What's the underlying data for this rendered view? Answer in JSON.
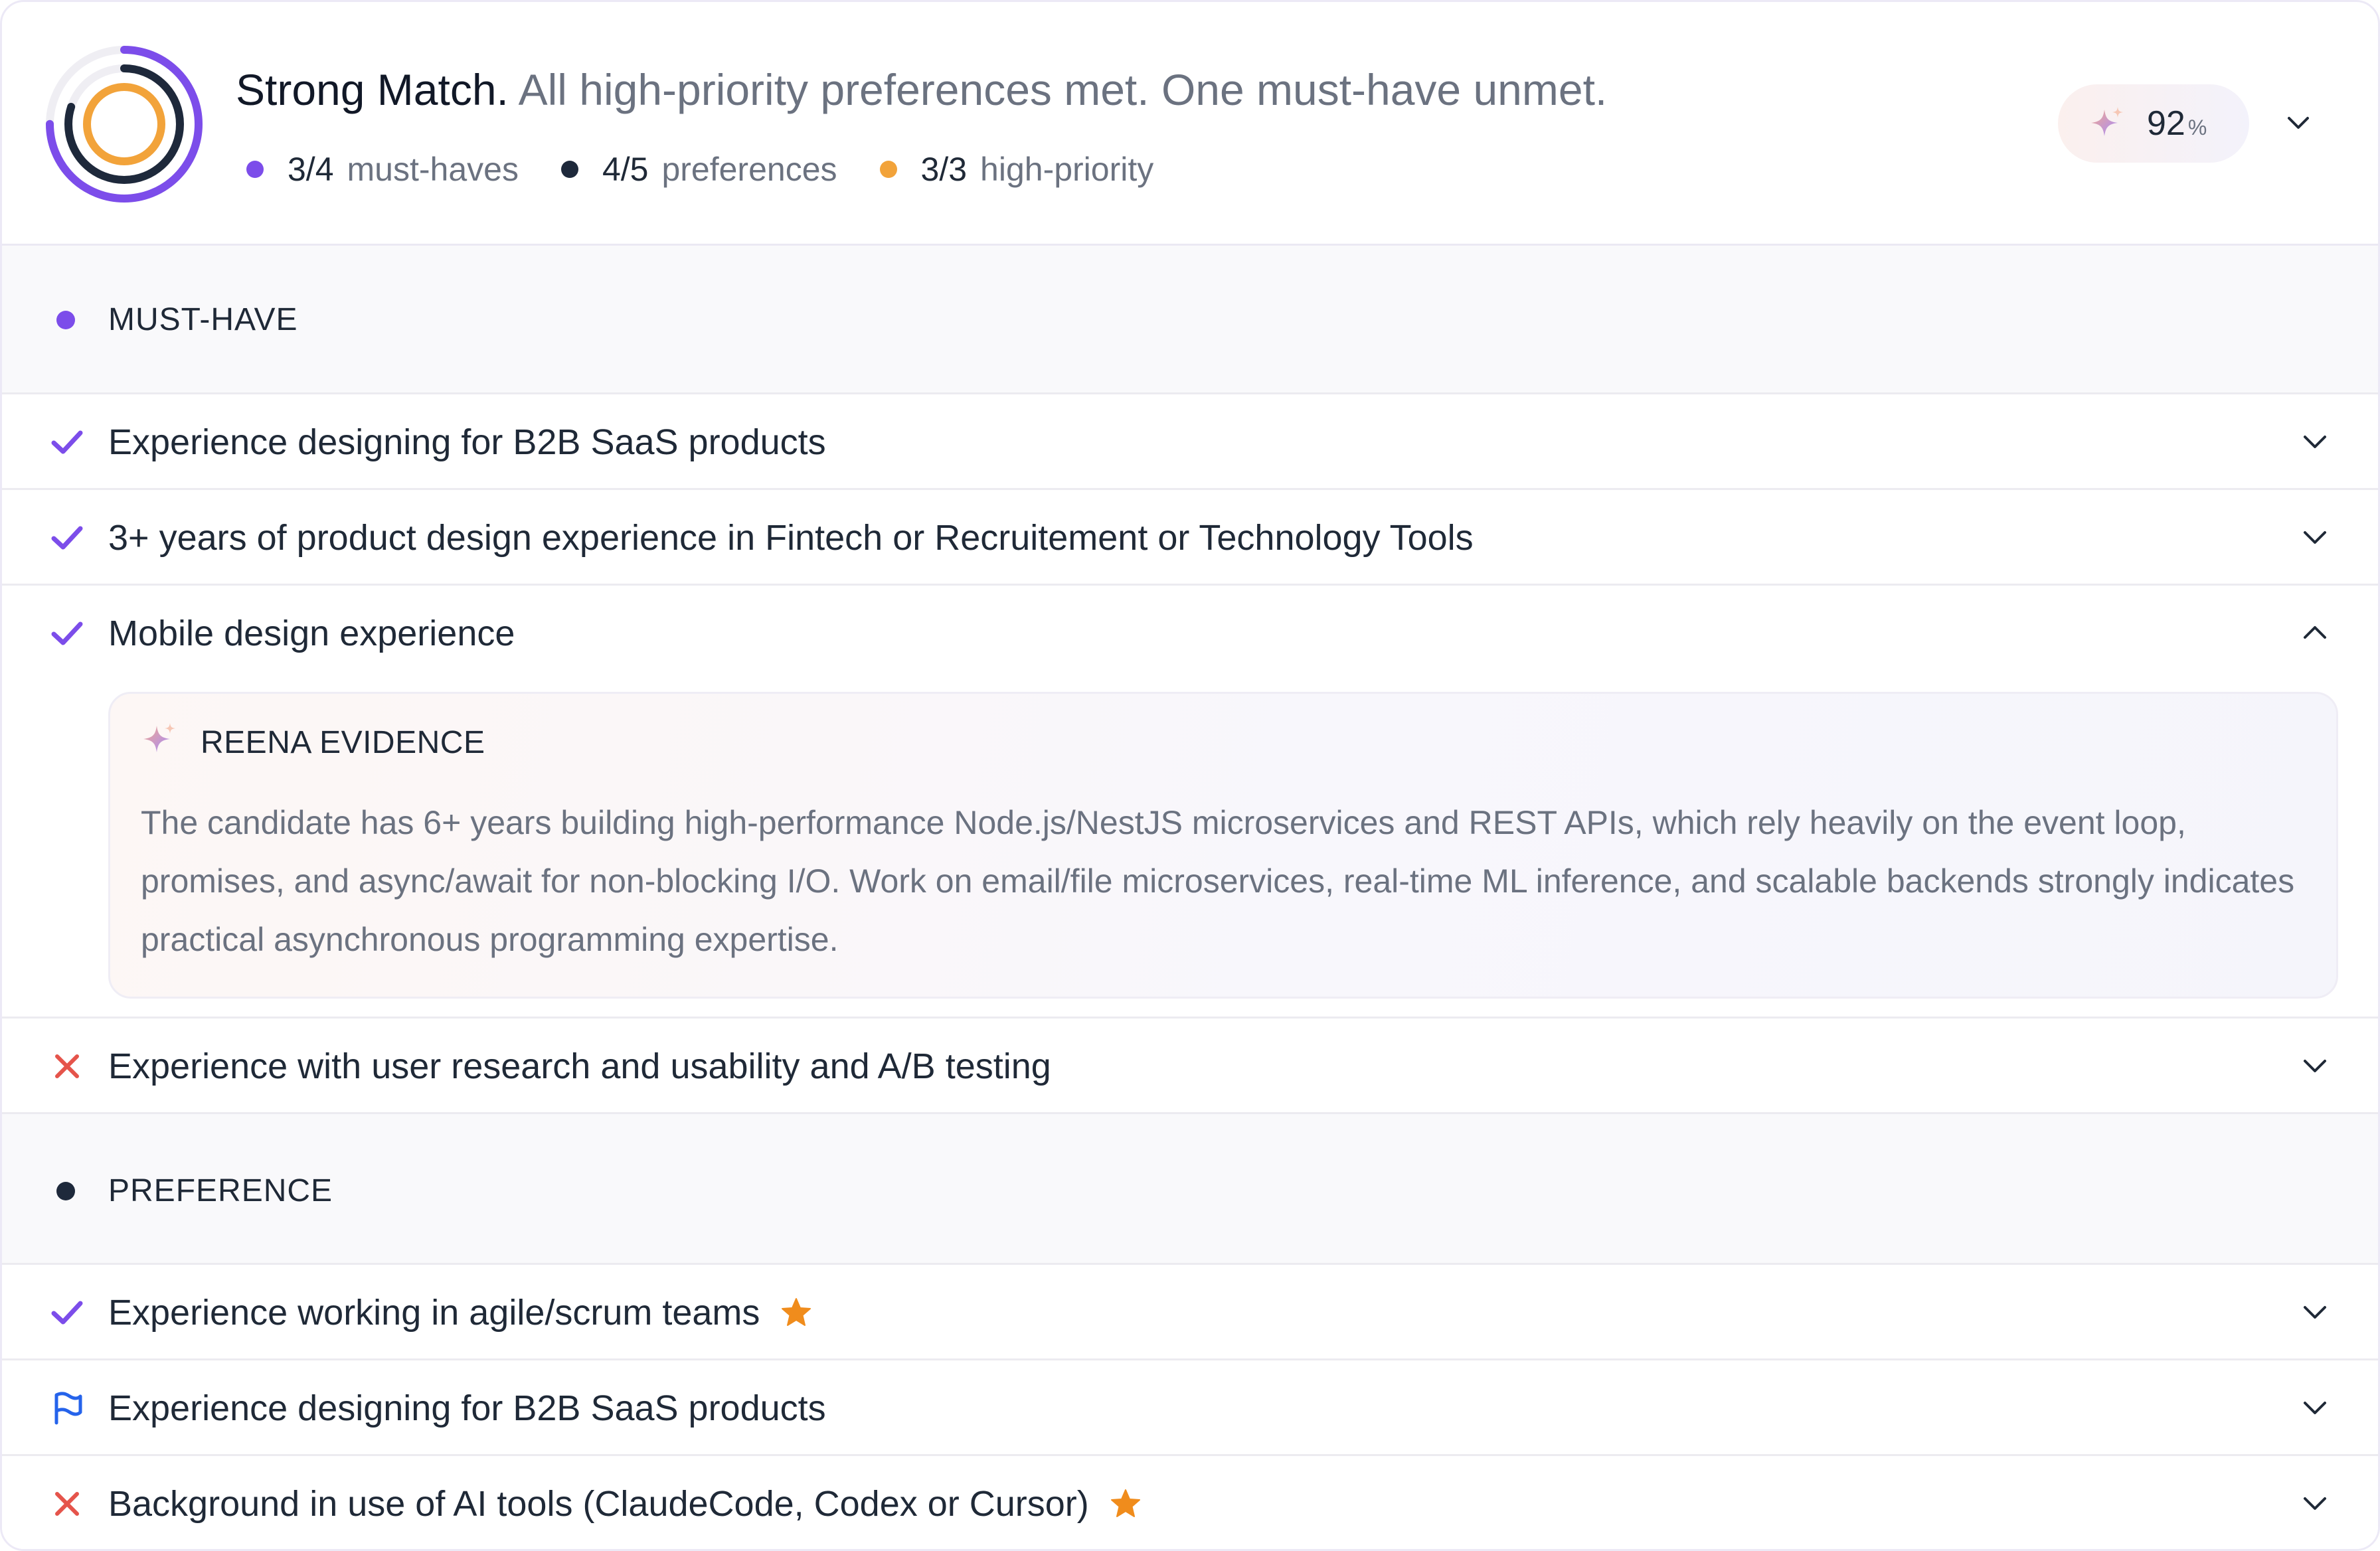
{
  "header": {
    "match_title": "Strong Match.",
    "match_summary": "All high-priority preferences met. One must-have unmet.",
    "stats": [
      {
        "value": "3/4",
        "label": "must-haves",
        "color": "#7c4dea"
      },
      {
        "value": "4/5",
        "label": "preferences",
        "color": "#1e293b"
      },
      {
        "value": "3/3",
        "label": "high-priority",
        "color": "#f2a33a"
      }
    ],
    "score": {
      "value": "92",
      "unit": "%"
    },
    "ring": {
      "must_have_fraction": 0.75,
      "preference_fraction": 0.8,
      "high_priority_fraction": 1.0
    }
  },
  "sections": {
    "must_have": {
      "title": "MUST-HAVE",
      "dot_color": "#7c4dea",
      "items": [
        {
          "label": "Experience designing for B2B SaaS products",
          "status": "met"
        },
        {
          "label": "3+ years of product design experience in Fintech or Recruitement or Technology Tools",
          "status": "met"
        },
        {
          "label": "Mobile design experience",
          "status": "met",
          "expanded": true
        },
        {
          "label": "Experience with user research and usability and A/B testing",
          "status": "unmet"
        }
      ],
      "evidence": {
        "title": "REENA EVIDENCE",
        "body": "The candidate has 6+ years building high-performance Node.js/NestJS microservices and REST APIs, which rely heavily on the event loop, promises, and async/await for non-blocking I/O. Work on email/file microservices, real-time ML inference, and scalable backends strongly indicates practical asynchronous programming expertise."
      }
    },
    "preference": {
      "title": "PREFERENCE",
      "dot_color": "#1e293b",
      "items": [
        {
          "label": "Experience working in agile/scrum teams",
          "status": "met",
          "high_priority": true
        },
        {
          "label": "Experience designing for B2B SaaS products",
          "status": "flagged",
          "high_priority": false
        },
        {
          "label": "Background in use of AI tools (ClaudeCode, Codex or Cursor)",
          "status": "unmet",
          "high_priority": true
        }
      ]
    }
  },
  "colors": {
    "accent_purple": "#7c4dea",
    "navy": "#1e293b",
    "amber": "#f2a33a",
    "unmet_red": "#e5544b",
    "flag_blue": "#2563eb",
    "star_orange": "#f08c1c"
  }
}
